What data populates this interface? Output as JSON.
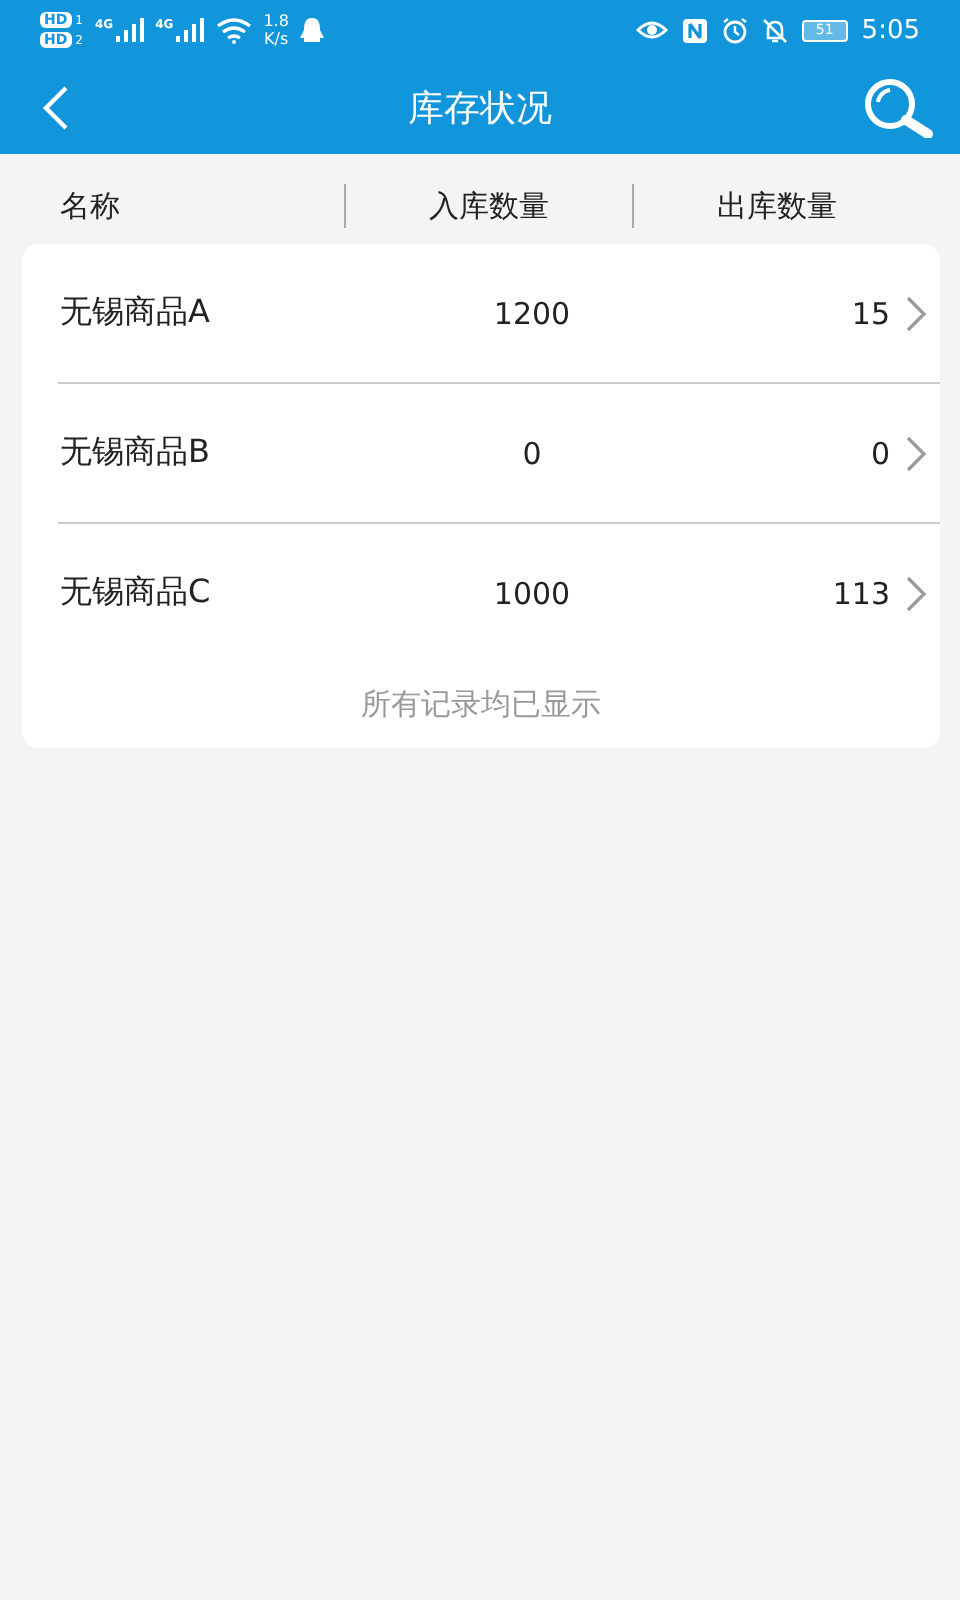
{
  "status_bar": {
    "sim_badges": [
      {
        "label": "HD",
        "slot": "1"
      },
      {
        "label": "HD",
        "slot": "2"
      }
    ],
    "networks": [
      "4G",
      "4G"
    ],
    "speed": "1.8",
    "speed_unit": "K/s",
    "battery": "51",
    "time": "5:05"
  },
  "header": {
    "title": "库存状况"
  },
  "columns": [
    "名称",
    "入库数量",
    "出库数量"
  ],
  "rows": [
    {
      "name": "无锡商品A",
      "in_qty": "1200",
      "out_qty": "15"
    },
    {
      "name": "无锡商品B",
      "in_qty": "0",
      "out_qty": "0"
    },
    {
      "name": "无锡商品C",
      "in_qty": "1000",
      "out_qty": "113"
    }
  ],
  "footer_note": "所有记录均已显示"
}
